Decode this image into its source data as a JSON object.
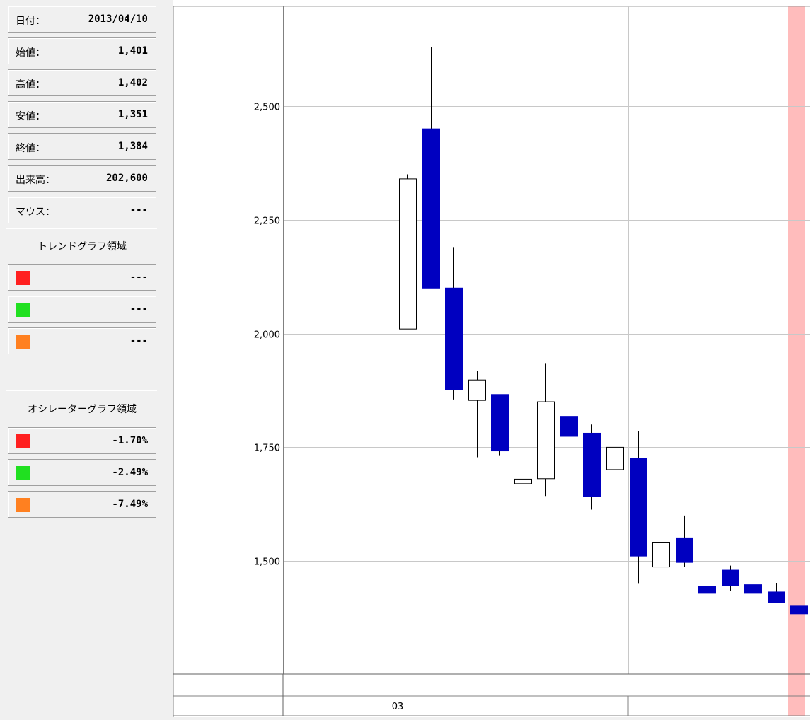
{
  "info": {
    "date_label": "日付：",
    "date": "2013/04/10",
    "open_label": "始値：",
    "open": "1,401",
    "high_label": "高値：",
    "high": "1,402",
    "low_label": "安値：",
    "low": "1,351",
    "close_label": "終値：",
    "close": "1,384",
    "volume_label": "出来高：",
    "volume": "202,600",
    "mouse_label": "マウス：",
    "mouse": "---"
  },
  "trend": {
    "title": "トレンドグラフ領域",
    "items": [
      {
        "color": "#ff2020",
        "value": "---"
      },
      {
        "color": "#20e020",
        "value": "---"
      },
      {
        "color": "#ff8020",
        "value": "---"
      }
    ]
  },
  "oscillator": {
    "title": "オシレーターグラフ領域",
    "items": [
      {
        "color": "#ff2020",
        "value": "-1.70%"
      },
      {
        "color": "#20e020",
        "value": "-2.49%"
      },
      {
        "color": "#ff8020",
        "value": "-7.49%"
      }
    ]
  },
  "chart_data": {
    "type": "candlestick",
    "y_ticks": [
      2500,
      2250,
      2000,
      1750,
      1500
    ],
    "y_tick_labels": [
      "2,500",
      "2,250",
      "2,000",
      "1,750",
      "1,500"
    ],
    "x_tick_label": "03",
    "up_color": "#ffffff",
    "down_color": "#0000c0",
    "highlight_color": "#ffbcbc",
    "candles": [
      {
        "open": 2010,
        "close": 2340,
        "high": 2350,
        "low": 2010
      },
      {
        "open": 2450,
        "close": 2100,
        "high": 2630,
        "low": 2100
      },
      {
        "open": 2100,
        "close": 1877,
        "high": 2190,
        "low": 1855
      },
      {
        "open": 1853,
        "close": 1898,
        "high": 1918,
        "low": 1728
      },
      {
        "open": 1866,
        "close": 1742,
        "high": 1866,
        "low": 1731
      },
      {
        "open": 1670,
        "close": 1680,
        "high": 1815,
        "low": 1613
      },
      {
        "open": 1681,
        "close": 1850,
        "high": 1935,
        "low": 1643
      },
      {
        "open": 1818,
        "close": 1774,
        "high": 1888,
        "low": 1760
      },
      {
        "open": 1781,
        "close": 1642,
        "high": 1800,
        "low": 1613
      },
      {
        "open": 1701,
        "close": 1750,
        "high": 1840,
        "low": 1648
      },
      {
        "open": 1725,
        "close": 1511,
        "high": 1786,
        "low": 1450
      },
      {
        "open": 1487,
        "close": 1540,
        "high": 1583,
        "low": 1373
      },
      {
        "open": 1551,
        "close": 1497,
        "high": 1600,
        "low": 1487
      },
      {
        "open": 1445,
        "close": 1429,
        "high": 1475,
        "low": 1420
      },
      {
        "open": 1480,
        "close": 1446,
        "high": 1490,
        "low": 1435
      },
      {
        "open": 1448,
        "close": 1429,
        "high": 1481,
        "low": 1410
      },
      {
        "open": 1432,
        "close": 1409,
        "high": 1451,
        "low": 1409
      },
      {
        "open": 1401,
        "close": 1384,
        "high": 1402,
        "low": 1351
      }
    ]
  }
}
